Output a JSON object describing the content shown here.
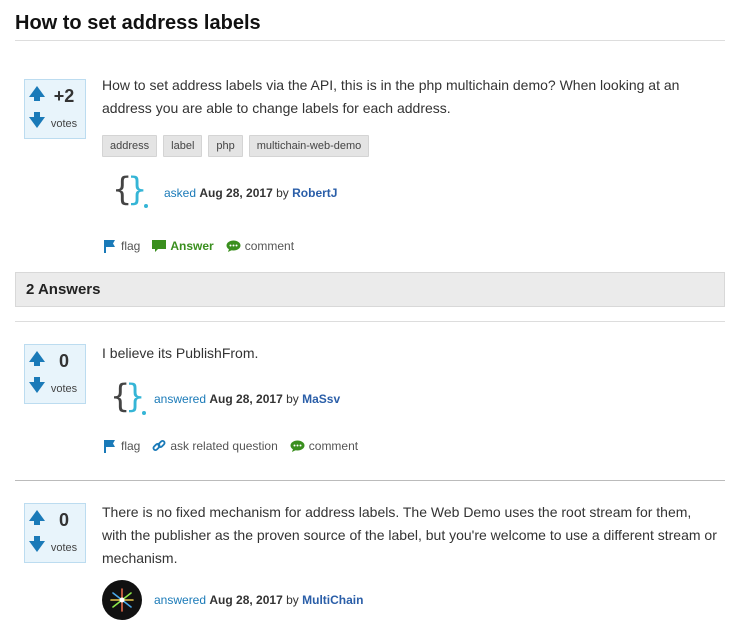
{
  "page_title": "How to set address labels",
  "question": {
    "votes": "+2",
    "votes_label": "votes",
    "text": "How to set address labels via the API, this is in the php multichain demo? When looking at an address you are able to change labels for each address.",
    "tags": [
      "address",
      "label",
      "php",
      "multichain-web-demo"
    ],
    "meta": {
      "what": "asked",
      "when": "Aug 28, 2017",
      "by": "by",
      "who": "RobertJ"
    },
    "actions": {
      "flag": "flag",
      "answer": "Answer",
      "comment": "comment"
    }
  },
  "answers_header": "2 Answers",
  "answers": [
    {
      "votes": "0",
      "votes_label": "votes",
      "text": "I believe its PublishFrom.",
      "meta": {
        "what": "answered",
        "when": "Aug 28, 2017",
        "by": "by",
        "who": "MaSsv"
      },
      "actions": {
        "flag": "flag",
        "related": "ask related question",
        "comment": "comment"
      }
    },
    {
      "votes": "0",
      "votes_label": "votes",
      "text": "There is no fixed mechanism for address labels. The Web Demo uses the root stream for them, with the publisher as the proven source of the label, but you're welcome to use a different stream or mechanism.",
      "meta": {
        "what": "answered",
        "when": "Aug 28, 2017",
        "by": "by",
        "who": "MultiChain"
      }
    }
  ],
  "colors": {
    "accent": "#1a7ab8",
    "answer_green": "#3a8f1e",
    "vote_bg": "#e8f4fb"
  }
}
